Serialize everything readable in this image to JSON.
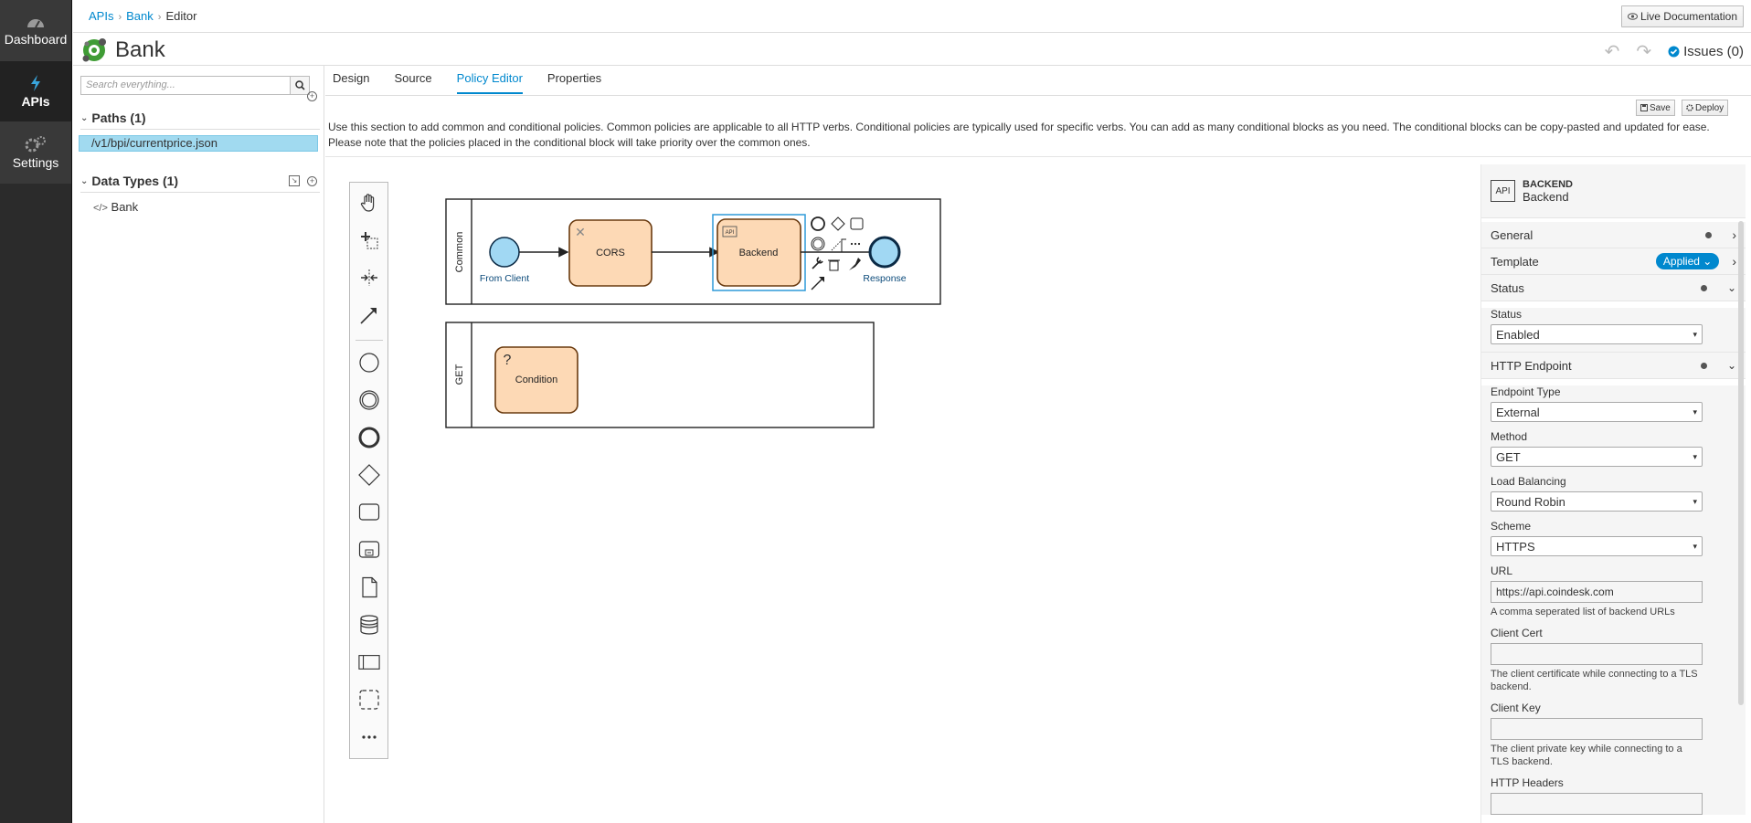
{
  "nav": {
    "items": [
      {
        "label": "Dashboard",
        "icon": "dashboard-icon"
      },
      {
        "label": "APIs",
        "icon": "bolt-icon"
      },
      {
        "label": "Settings",
        "icon": "gears-icon"
      }
    ]
  },
  "breadcrumb": [
    "APIs",
    "Bank",
    "Editor"
  ],
  "header": {
    "title": "Bank",
    "live_doc": "Live Documentation",
    "issues": "Issues (0)"
  },
  "left": {
    "search_placeholder": "Search everything...",
    "paths_title": "Paths (1)",
    "paths": [
      "/v1/bpi/currentprice.json"
    ],
    "datatypes_title": "Data Types (1)",
    "datatypes": [
      "Bank"
    ]
  },
  "tabs": [
    "Design",
    "Source",
    "Policy Editor",
    "Properties"
  ],
  "toolbar": {
    "save": "Save",
    "deploy": "Deploy"
  },
  "description": "Use this section to add common and conditional policies. Common policies are applicable to all HTTP verbs. Conditional policies are typically used for specific verbs. You can add as many conditional blocks as you need. The conditional blocks can be copy-pasted and updated for ease. Please note that the policies placed in the conditional block will take priority over the common ones.",
  "diagram": {
    "lanes": [
      "Common",
      "GET"
    ],
    "nodes": {
      "from_client": "From Client",
      "cors": "CORS",
      "backend": "Backend",
      "response": "Response",
      "condition": "Condition",
      "backend_badge": "API"
    }
  },
  "props": {
    "type": "BACKEND",
    "name": "Backend",
    "badge": "API",
    "sections": {
      "general": "General",
      "template": "Template",
      "template_badge": "Applied",
      "status": "Status",
      "http": "HTTP Endpoint"
    },
    "fields": {
      "status_label": "Status",
      "status_value": "Enabled",
      "endpoint_type_label": "Endpoint Type",
      "endpoint_type_value": "External",
      "method_label": "Method",
      "method_value": "GET",
      "lb_label": "Load Balancing",
      "lb_value": "Round Robin",
      "scheme_label": "Scheme",
      "scheme_value": "HTTPS",
      "url_label": "URL",
      "url_value": "https://api.coindesk.com",
      "url_help": "A comma seperated list of backend URLs",
      "cert_label": "Client Cert",
      "cert_help": "The client certificate while connecting to a TLS backend.",
      "key_label": "Client Key",
      "key_help": "The client private key while connecting to a TLS backend.",
      "headers_label": "HTTP Headers"
    }
  },
  "colors": {
    "accent": "#0088ce",
    "node_fill": "#fdd9b5",
    "node_stroke": "#b86e2a",
    "event_fill": "#a1d8f3"
  }
}
